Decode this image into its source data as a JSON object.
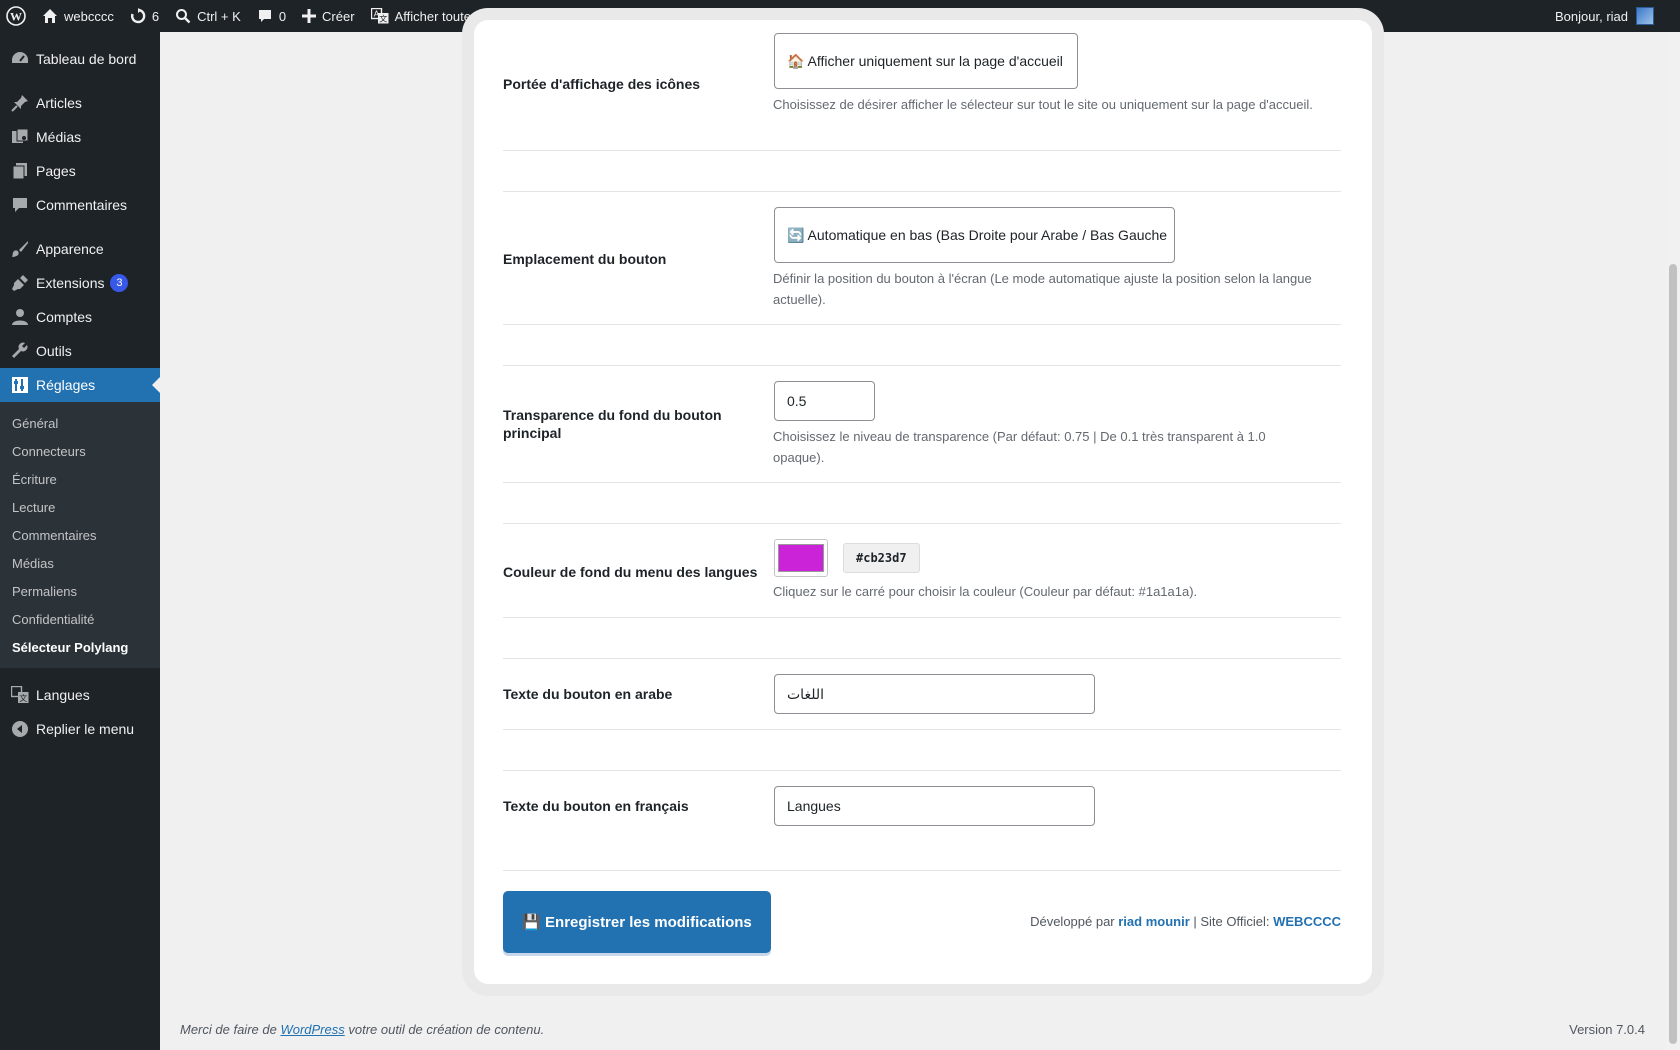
{
  "adminbar": {
    "site_name": "webcccc",
    "updates_count": "6",
    "search_shortcut": "Ctrl + K",
    "comments_count": "0",
    "create_label": "Créer",
    "languages_label": "Afficher toutes les langues",
    "greeting": "Bonjour, riad"
  },
  "sidebar": {
    "items": [
      {
        "label": "Tableau de bord",
        "icon": "dashboard-icon"
      },
      {
        "label": "Articles",
        "icon": "pin-icon"
      },
      {
        "label": "Médias",
        "icon": "media-icon"
      },
      {
        "label": "Pages",
        "icon": "pages-icon"
      },
      {
        "label": "Commentaires",
        "icon": "comments-icon"
      },
      {
        "label": "Apparence",
        "icon": "appearance-icon"
      },
      {
        "label": "Extensions",
        "icon": "plugins-icon",
        "badge": "3"
      },
      {
        "label": "Comptes",
        "icon": "users-icon"
      },
      {
        "label": "Outils",
        "icon": "tools-icon"
      },
      {
        "label": "Réglages",
        "icon": "settings-icon"
      }
    ],
    "submenu": [
      "Général",
      "Connecteurs",
      "Écriture",
      "Lecture",
      "Commentaires",
      "Médias",
      "Permaliens",
      "Confidentialité",
      "Sélecteur Polylang"
    ],
    "languages": "Langues",
    "collapse": "Replier le menu"
  },
  "settings": {
    "scope": {
      "label": "Portée d'affichage des icônes",
      "value": "🏠 Afficher uniquement sur la page d'accueil",
      "description": "Choisissez de désirer afficher le sélecteur sur tout le site ou uniquement sur la page d'accueil."
    },
    "position": {
      "label": "Emplacement du bouton",
      "value": "🔄 Automatique en bas (Bas Droite pour Arabe / Bas Gauche",
      "description": "Définir la position du bouton à l'écran (Le mode automatique ajuste la position selon la langue actuelle)."
    },
    "opacity": {
      "label": "Transparence du fond du bouton principal",
      "value": "0.5",
      "description": "Choisissez le niveau de transparence (Par défaut: 0.75 | De 0.1 très transparent à 1.0 opaque)."
    },
    "menu_color": {
      "label": "Couleur de fond du menu des langues",
      "value": "#cb23d7",
      "description": "Cliquez sur le carré pour choisir la couleur (Couleur par défaut: #1a1a1a)."
    },
    "arabic_text": {
      "label": "Texte du bouton en arabe",
      "value": "اللغات"
    },
    "french_text": {
      "label": "Texte du bouton en français",
      "value": "Langues"
    }
  },
  "save_button": "💾 Enregistrer les modifications",
  "credits": {
    "prefix": "Développé par ",
    "author": "riad mounir",
    "middle": " | Site Officiel: ",
    "site": "WEBCCCC"
  },
  "footer": {
    "prefix": "Merci de faire de ",
    "link": "WordPress",
    "suffix": " votre outil de création de contenu.",
    "version": "Version 7.0.4"
  },
  "colors": {
    "accent": "#2271b1",
    "sidebar_bg": "#1d2327",
    "swatch": "#cb23d7"
  }
}
